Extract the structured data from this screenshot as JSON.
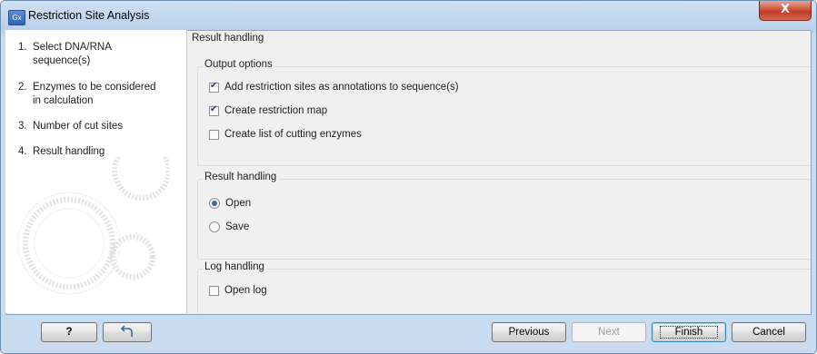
{
  "window": {
    "title": "Restriction Site Analysis",
    "app_icon_label": "Gx",
    "close_glyph": "X"
  },
  "steps": [
    {
      "number": "1.",
      "line1": "Select DNA/RNA",
      "line2": "sequence(s)"
    },
    {
      "number": "2.",
      "line1": "Enzymes to be considered",
      "line2": "in calculation"
    },
    {
      "number": "3.",
      "line1": "Number of cut sites",
      "line2": ""
    },
    {
      "number": "4.",
      "line1": "Result handling",
      "line2": ""
    }
  ],
  "main": {
    "heading": "Result handling",
    "output_options": {
      "title": "Output options",
      "items": [
        {
          "label": "Add restriction sites as annotations to sequence(s)",
          "checked": true
        },
        {
          "label": "Create restriction map",
          "checked": true
        },
        {
          "label": "Create list of cutting enzymes",
          "checked": false
        }
      ]
    },
    "result_handling": {
      "title": "Result handling",
      "options": [
        {
          "label": "Open",
          "selected": true
        },
        {
          "label": "Save",
          "selected": false
        }
      ]
    },
    "log_handling": {
      "title": "Log handling",
      "items": [
        {
          "label": "Open log",
          "checked": false
        }
      ]
    }
  },
  "footer": {
    "help_label": "?",
    "reset_icon": "reset-arrow-icon",
    "previous_label": "Previous",
    "next_label": "Next",
    "finish_label": "Finish",
    "cancel_label": "Cancel"
  },
  "colors": {
    "title_bar": "#c8dbef",
    "close_button": "#c94a33",
    "checkmark": "#2a3f6a",
    "radio_dot": "#1f4d8c"
  }
}
